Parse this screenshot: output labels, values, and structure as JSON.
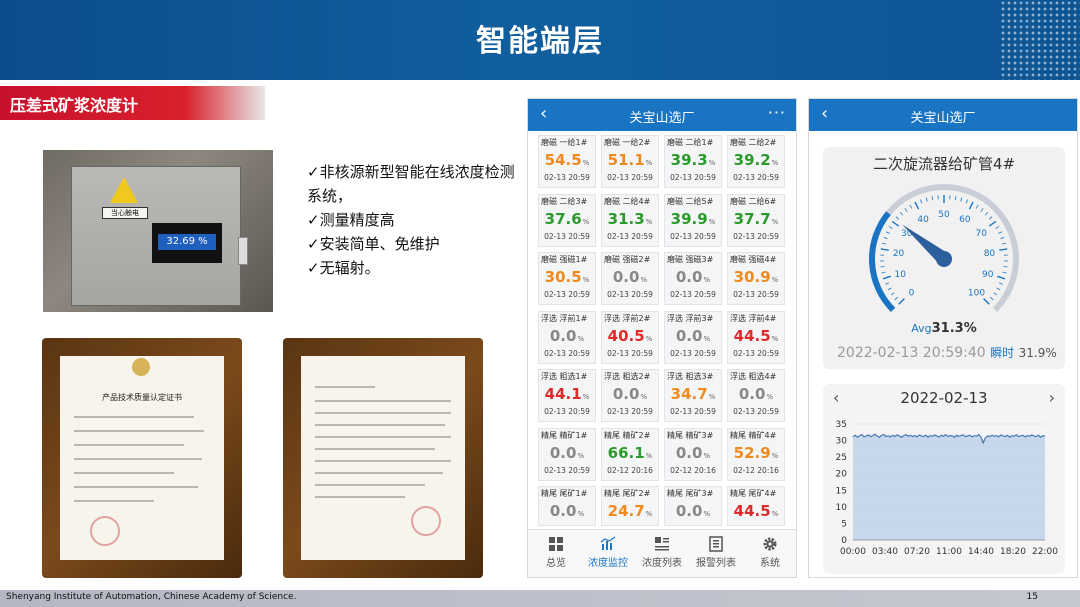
{
  "slide": {
    "title": "智能端层",
    "section": "压差式矿浆浓度计",
    "footer_org": "Shenyang Institute of Automation, Chinese Academy of Science.",
    "page_number": "15"
  },
  "photo": {
    "warning_label": "当心触电",
    "screen_value": "32.69 %"
  },
  "bullets": [
    "✓非核源新型智能在线浓度检测系统，",
    "✓测量精度高",
    "✓安装简单、免维护",
    "✓无辐射。"
  ],
  "certificates": [
    {
      "title": "产品技术质量认定证书"
    },
    {
      "title": ""
    }
  ],
  "phone1": {
    "header_title": "关宝山选厂",
    "back_icon": "chevron-left-icon",
    "more_icon": "more-horizontal-icon",
    "cells": [
      {
        "name": "磨磁 一给1#",
        "value": "54.5",
        "unit": "%",
        "time": "02-13  20:59",
        "color": "#f08a1c"
      },
      {
        "name": "磨磁 一给2#",
        "value": "51.1",
        "unit": "%",
        "time": "02-13  20:59",
        "color": "#f08a1c"
      },
      {
        "name": "磨磁 二给1#",
        "value": "39.3",
        "unit": "%",
        "time": "02-13  20:59",
        "color": "#2a9a2a"
      },
      {
        "name": "磨磁 二给2#",
        "value": "39.2",
        "unit": "%",
        "time": "02-13  20:59",
        "color": "#2a9a2a"
      },
      {
        "name": "磨磁 二给3#",
        "value": "37.6",
        "unit": "%",
        "time": "02-13  20:59",
        "color": "#2a9a2a"
      },
      {
        "name": "磨磁 二给4#",
        "value": "31.3",
        "unit": "%",
        "time": "02-13  20:59",
        "color": "#2a9a2a"
      },
      {
        "name": "磨磁 二给5#",
        "value": "39.9",
        "unit": "%",
        "time": "02-13  20:59",
        "color": "#2a9a2a"
      },
      {
        "name": "磨磁 二给6#",
        "value": "37.7",
        "unit": "%",
        "time": "02-13  20:59",
        "color": "#2a9a2a"
      },
      {
        "name": "磨磁 强磁1#",
        "value": "30.5",
        "unit": "%",
        "time": "02-13  20:59",
        "color": "#f08a1c"
      },
      {
        "name": "磨磁 强磁2#",
        "value": "0.0",
        "unit": "%",
        "time": "02-13  20:59",
        "color": "#888888"
      },
      {
        "name": "磨磁 强磁3#",
        "value": "0.0",
        "unit": "%",
        "time": "02-13  20:59",
        "color": "#888888"
      },
      {
        "name": "磨磁 强磁4#",
        "value": "30.9",
        "unit": "%",
        "time": "02-13  20:59",
        "color": "#f08a1c"
      },
      {
        "name": "浮选 浮前1#",
        "value": "0.0",
        "unit": "%",
        "time": "02-13  20:59",
        "color": "#888888"
      },
      {
        "name": "浮选 浮前2#",
        "value": "40.5",
        "unit": "%",
        "time": "02-13  20:59",
        "color": "#e02a2a"
      },
      {
        "name": "浮选 浮前3#",
        "value": "0.0",
        "unit": "%",
        "time": "02-13  20:59",
        "color": "#888888"
      },
      {
        "name": "浮选 浮前4#",
        "value": "44.5",
        "unit": "%",
        "time": "02-13  20:59",
        "color": "#e02a2a"
      },
      {
        "name": "浮选 粗选1#",
        "value": "44.1",
        "unit": "%",
        "time": "02-13  20:59",
        "color": "#e02a2a"
      },
      {
        "name": "浮选 粗选2#",
        "value": "0.0",
        "unit": "%",
        "time": "02-13  20:59",
        "color": "#888888"
      },
      {
        "name": "浮选 粗选3#",
        "value": "34.7",
        "unit": "%",
        "time": "02-13  20:59",
        "color": "#f08a1c"
      },
      {
        "name": "浮选 粗选4#",
        "value": "0.0",
        "unit": "%",
        "time": "02-13  20:59",
        "color": "#888888"
      },
      {
        "name": "精尾 精矿1#",
        "value": "0.0",
        "unit": "%",
        "time": "02-13  20:59",
        "color": "#888888"
      },
      {
        "name": "精尾 精矿2#",
        "value": "66.1",
        "unit": "%",
        "time": "02-12  20:16",
        "color": "#2a9a2a"
      },
      {
        "name": "精尾 精矿3#",
        "value": "0.0",
        "unit": "%",
        "time": "02-12  20:16",
        "color": "#888888"
      },
      {
        "name": "精尾 精矿4#",
        "value": "52.9",
        "unit": "%",
        "time": "02-12  20:16",
        "color": "#f08a1c"
      },
      {
        "name": "精尾 尾矿1#",
        "value": "0.0",
        "unit": "%",
        "time": "",
        "color": "#888888"
      },
      {
        "name": "精尾 尾矿2#",
        "value": "24.7",
        "unit": "%",
        "time": "",
        "color": "#f08a1c"
      },
      {
        "name": "精尾 尾矿3#",
        "value": "0.0",
        "unit": "%",
        "time": "",
        "color": "#888888"
      },
      {
        "name": "精尾 尾矿4#",
        "value": "44.5",
        "unit": "%",
        "time": "",
        "color": "#e02a2a"
      }
    ],
    "nav": [
      {
        "label": "总览",
        "icon": "grid-icon"
      },
      {
        "label": "浓度监控",
        "icon": "bar-chart-icon",
        "active": true
      },
      {
        "label": "浓度列表",
        "icon": "list-card-icon"
      },
      {
        "label": "报警列表",
        "icon": "alarm-list-icon"
      },
      {
        "label": "系统",
        "icon": "gear-icon"
      }
    ]
  },
  "phone2": {
    "header_title": "关宝山选厂",
    "back_icon": "chevron-left-icon",
    "gauge": {
      "title": "二次旋流器给矿管4#",
      "ticks": [
        "0",
        "10",
        "20",
        "30",
        "40",
        "50",
        "60",
        "70",
        "80",
        "90",
        "100"
      ],
      "avg_label": "Avg",
      "avg_value": "31.3%",
      "timestamp": "2022-02-13 20:59:40",
      "instant_label": "瞬时",
      "instant_value": "31.9%",
      "accent_color": "#1a74c4"
    },
    "chart_nav": {
      "date": "2022-02-13",
      "prev_icon": "chevron-left-icon",
      "next_icon": "chevron-right-icon"
    }
  },
  "chart_data": {
    "type": "area",
    "title": "",
    "xlabel": "",
    "ylabel": "",
    "x": [
      "00:00",
      "03:40",
      "07:20",
      "11:00",
      "14:40",
      "18:20",
      "22:00"
    ],
    "ylim": [
      0,
      35
    ],
    "yticks": [
      0,
      5,
      10,
      15,
      20,
      25,
      30,
      35
    ],
    "grid": true,
    "series": [
      {
        "values": [
          31.2,
          31.6,
          31.0,
          31.5,
          31.8,
          31.1,
          31.4,
          31.7,
          31.2,
          31.5,
          31.9,
          31.3,
          31.0,
          31.6,
          31.8,
          31.2,
          31.4,
          31.1,
          31.6,
          31.3,
          31.7,
          31.4,
          31.0,
          31.5,
          31.8,
          31.3,
          31.6,
          31.2,
          31.5,
          31.1,
          31.7,
          31.4,
          31.2,
          31.6,
          31.0,
          31.5,
          31.3,
          31.7,
          31.4,
          31.1,
          31.6,
          31.3,
          31.8,
          31.2,
          31.5,
          31.4,
          31.0,
          31.6,
          31.3,
          31.5,
          31.7,
          31.2,
          31.4,
          31.6,
          31.1,
          31.5,
          31.3,
          31.8,
          31.0,
          29.3,
          30.8,
          31.4,
          31.2,
          31.6,
          31.3,
          31.5,
          31.1,
          31.7,
          31.4,
          31.2,
          31.6,
          31.0,
          31.5,
          31.3,
          31.8,
          31.2,
          31.4,
          31.6,
          31.1,
          31.5,
          31.3,
          31.7,
          31.4,
          31.2,
          31.6,
          31.0,
          31.5,
          31.3
        ]
      }
    ],
    "color": "#4a76b8"
  }
}
